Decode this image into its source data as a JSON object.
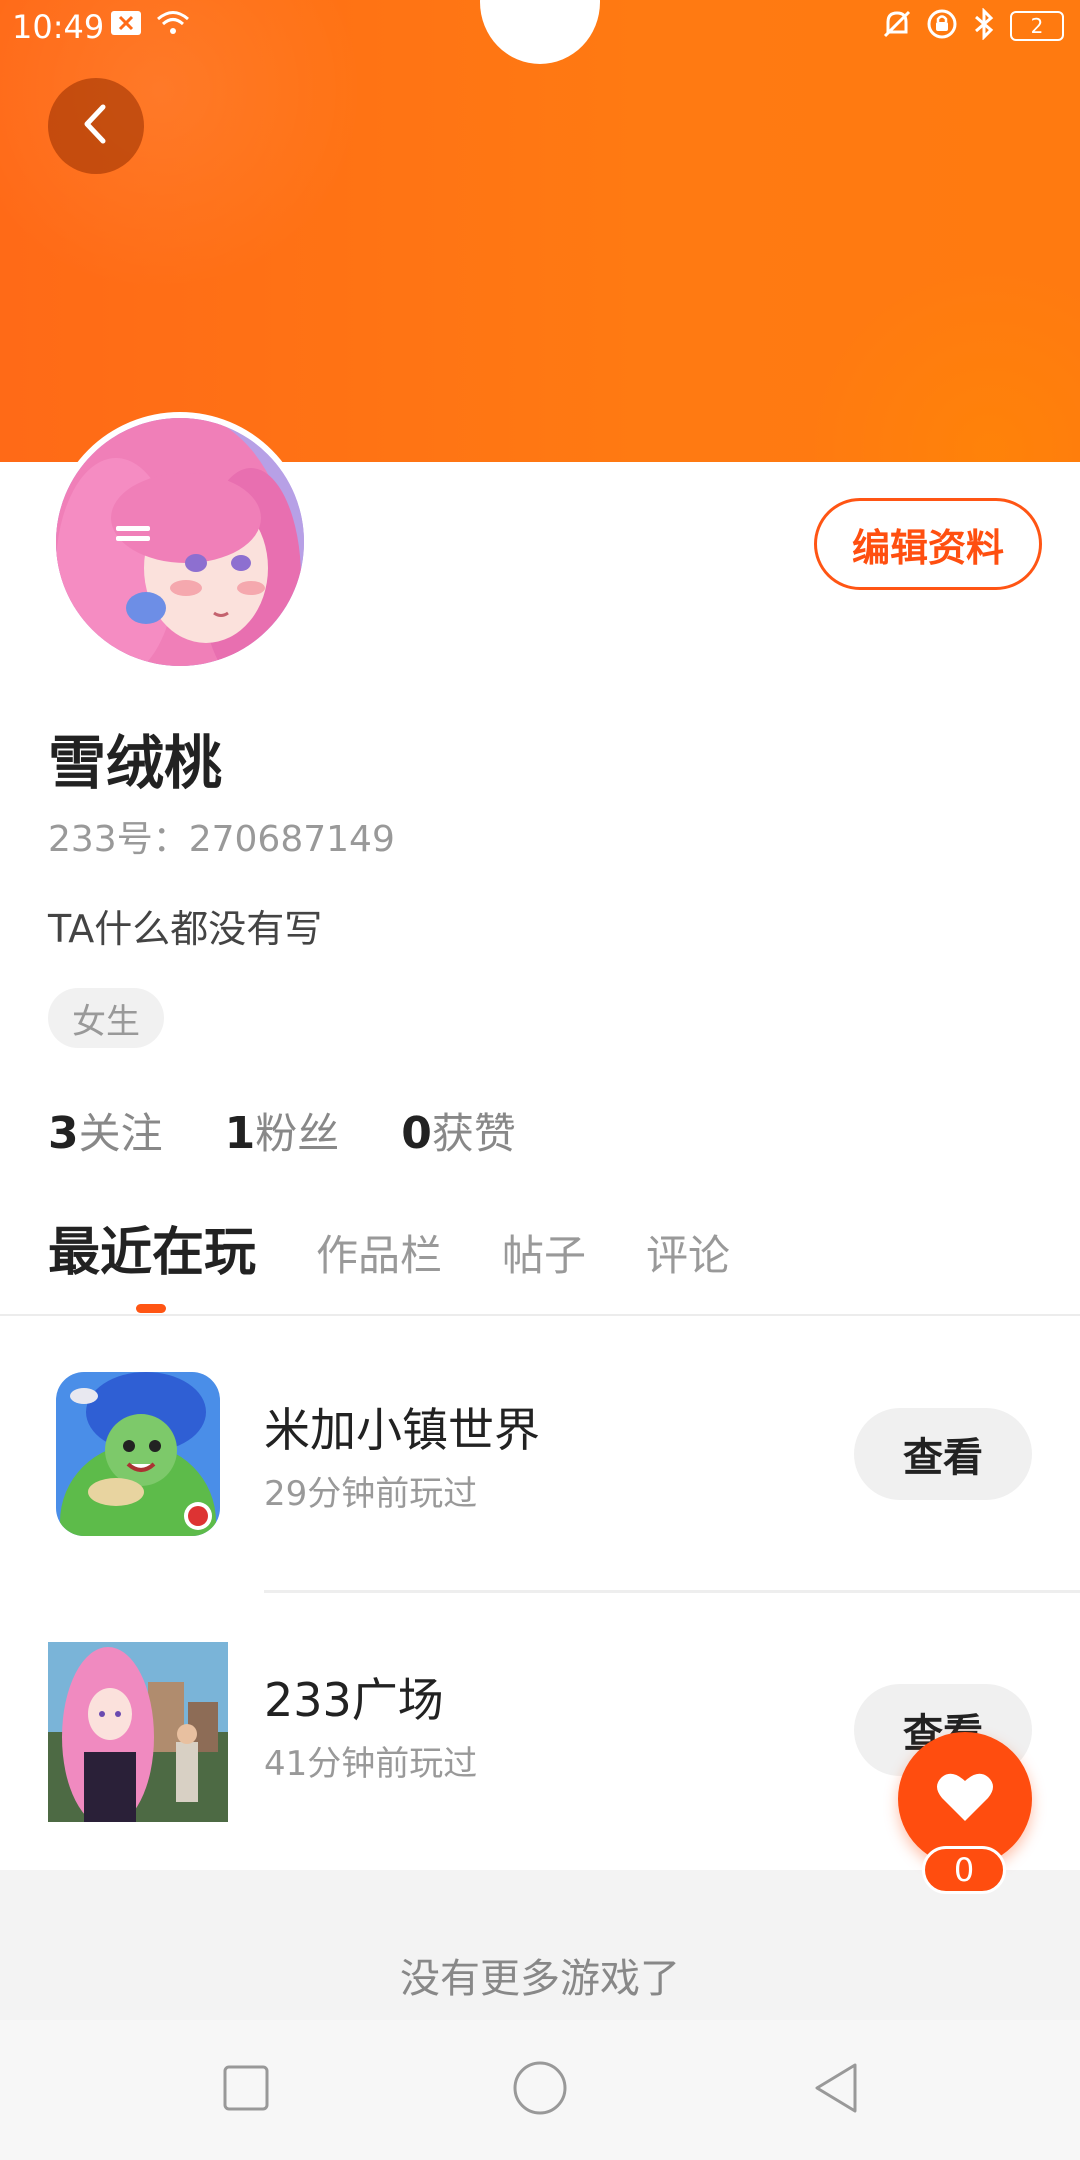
{
  "status_bar": {
    "time": "10:49",
    "battery": "2",
    "icons_left": [
      "sim-card-x-icon",
      "wifi-icon"
    ],
    "icons_right": [
      "bell-off-icon",
      "lock-rotation-icon",
      "bluetooth-icon",
      "battery-icon"
    ]
  },
  "header": {
    "back_icon": "chevron-left-icon",
    "accent_color": "#ff6a17"
  },
  "profile": {
    "edit_button": "编辑资料",
    "username": "雪绒桃",
    "user_id": "233号：270687149",
    "bio": "TA什么都没有写",
    "gender_tag": "女生",
    "stats": [
      {
        "value": "3",
        "label": "关注"
      },
      {
        "value": "1",
        "label": "粉丝"
      },
      {
        "value": "0",
        "label": "获赞"
      }
    ]
  },
  "tabs": [
    {
      "label": "最近在玩",
      "active": true
    },
    {
      "label": "作品栏",
      "active": false
    },
    {
      "label": "帖子",
      "active": false
    },
    {
      "label": "评论",
      "active": false
    }
  ],
  "games": [
    {
      "name": "米加小镇世界",
      "played": "29分钟前玩过",
      "button": "查看"
    },
    {
      "name": "233广场",
      "played": "41分钟前玩过",
      "button": "查看"
    }
  ],
  "no_more_text": "没有更多游戏了",
  "like": {
    "icon": "heart-icon",
    "count": "0"
  },
  "nav_bar": {
    "buttons": [
      "recents-square-icon",
      "home-circle-icon",
      "back-triangle-icon"
    ]
  }
}
